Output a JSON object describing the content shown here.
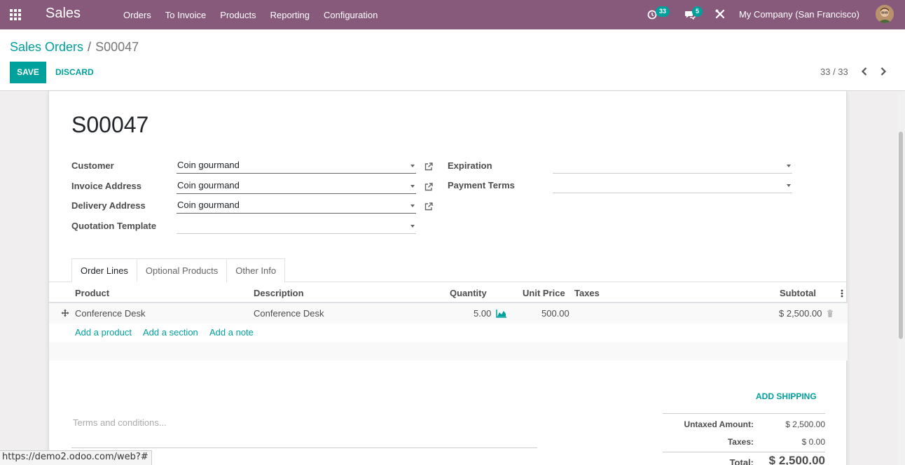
{
  "navbar": {
    "app_name": "Sales",
    "menu": [
      "Orders",
      "To Invoice",
      "Products",
      "Reporting",
      "Configuration"
    ],
    "activity_count": "33",
    "message_count": "5",
    "company": "My Company (San Francisco)"
  },
  "breadcrumb": {
    "parent": "Sales Orders",
    "separator": "/",
    "current": "S00047"
  },
  "buttons": {
    "save": "SAVE",
    "discard": "DISCARD"
  },
  "pager": {
    "value": "33 / 33"
  },
  "form": {
    "name": "S00047",
    "customer_label": "Customer",
    "customer_value": "Coin gourmand",
    "invoice_address_label": "Invoice Address",
    "invoice_address_value": "Coin gourmand",
    "delivery_address_label": "Delivery Address",
    "delivery_address_value": "Coin gourmand",
    "quotation_template_label": "Quotation Template",
    "quotation_template_value": "",
    "expiration_label": "Expiration",
    "expiration_value": "",
    "payment_terms_label": "Payment Terms",
    "payment_terms_value": ""
  },
  "tabs": [
    "Order Lines",
    "Optional Products",
    "Other Info"
  ],
  "table": {
    "headers": {
      "product": "Product",
      "description": "Description",
      "quantity": "Quantity",
      "unit_price": "Unit Price",
      "taxes": "Taxes",
      "subtotal": "Subtotal"
    },
    "rows": [
      {
        "product": "Conference Desk",
        "description": "Conference Desk",
        "quantity": "5.00",
        "unit_price": "500.00",
        "taxes": "",
        "subtotal": "$ 2,500.00"
      }
    ],
    "add_product": "Add a product",
    "add_section": "Add a section",
    "add_note": "Add a note"
  },
  "add_shipping": "ADD SHIPPING",
  "terms_placeholder": "Terms and conditions...",
  "totals": {
    "untaxed_label": "Untaxed Amount:",
    "untaxed_value": "$ 2,500.00",
    "taxes_label": "Taxes:",
    "taxes_value": "$ 0.00",
    "total_label": "Total:",
    "total_value": "$ 2,500.00"
  },
  "status_url": "https://demo2.odoo.com/web?#",
  "colors": {
    "navbar": "#875a7b",
    "primary": "#00a09d"
  }
}
